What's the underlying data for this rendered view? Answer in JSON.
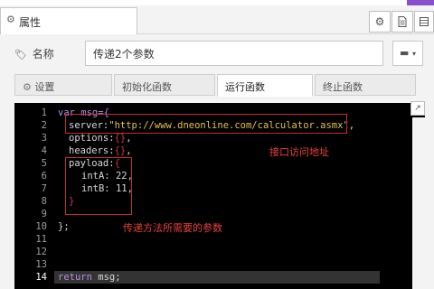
{
  "header": {
    "tab_label": "属性",
    "buttons": [
      "gear-icon",
      "document-icon",
      "table-icon"
    ],
    "accent_color": "#8a4fd1"
  },
  "name_field": {
    "label": "名称",
    "value": "传递2个参数"
  },
  "subtabs": [
    {
      "label": "设置",
      "icon": "gear-icon",
      "active": false
    },
    {
      "label": "初始化函数",
      "active": false
    },
    {
      "label": "运行函数",
      "active": true
    },
    {
      "label": "终止函数",
      "active": false
    }
  ],
  "editor": {
    "line_numbers": [
      "1",
      "2",
      "3",
      "4",
      "5",
      "6",
      "7",
      "8",
      "9",
      "10",
      "11",
      "12",
      "13",
      "14"
    ],
    "current_line": 14,
    "lines": {
      "l1": "var msg={",
      "l2_key": "server:",
      "l2_val": "\"http://www.dneonline.com/calculator.asmx\"",
      "l2_end": ",",
      "l3": "options:",
      "l3_val": "{}",
      "l3_end": ",",
      "l4": "headers:",
      "l4_val": "{}",
      "l4_end": ",",
      "l5": "payload:",
      "l5_val": "{",
      "l6_key": "intA:",
      "l6_val": "22",
      "l6_end": ",",
      "l7_key": "intB:",
      "l7_val": "11",
      "l7_end": ",",
      "l8": "}",
      "l10": "};",
      "l14_kw": "return",
      "l14_rest": " msg;"
    },
    "annotations": {
      "server_note": "接口访问地址",
      "payload_note": "传递方法所需要的参数",
      "color": "#e84040"
    }
  }
}
